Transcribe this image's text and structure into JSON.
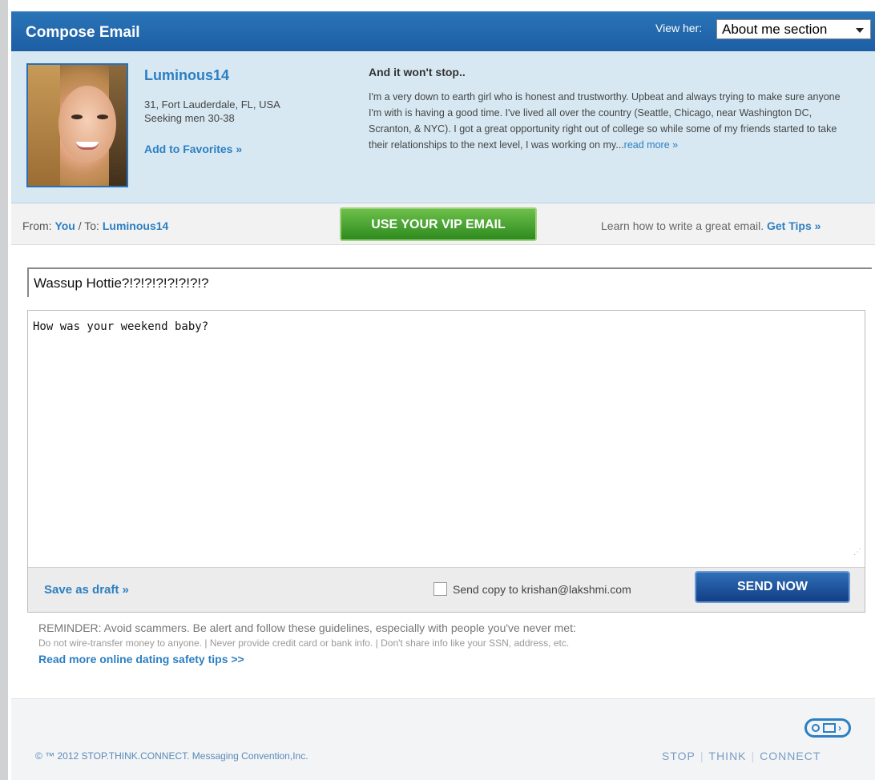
{
  "header": {
    "title": "Compose Email",
    "view_label": "View her:",
    "view_select_value": "About me section"
  },
  "profile": {
    "username": "Luminous14",
    "location": "31, Fort Lauderdale, FL, USA",
    "seeking": "Seeking men 30-38",
    "add_favorites": "Add to Favorites »",
    "about_title": "And it won't stop..",
    "about_text": "I'm a very down to earth girl who is honest and trustworthy. Upbeat and always trying to make sure anyone I'm with is having a good time. I've lived all over the country (Seattle, Chicago, near Washington DC, Scranton, & NYC). I got a great opportunity right out of college so while some of my friends started to take their relationships to the next level, I was working on my...",
    "read_more": "read more »"
  },
  "bar": {
    "from_label": "From:",
    "from_value": "You",
    "to_label": " / To:",
    "to_value": "Luminous14",
    "vip_button": "USE YOUR VIP EMAIL",
    "tips_text": "Learn how to write a great email.",
    "tips_link": "Get Tips »"
  },
  "compose": {
    "subject": "Wassup Hottie?!?!?!?!?!?!?!?",
    "body": "How was your weekend baby?",
    "save_draft": "Save as draft »",
    "send_copy_label": "Send copy to krishan@lakshmi.com",
    "send_copy_checked": false,
    "send_button": "SEND NOW"
  },
  "reminder": {
    "title": "REMINDER: Avoid scammers. Be alert and follow these guidelines, especially with people you've never met:",
    "line": "Do not wire-transfer money to anyone. | Never provide credit card or bank info. | Don't share info like your SSN, address, etc.",
    "safety_link": "Read more online dating safety tips >>"
  },
  "footer": {
    "copyright": "© ™ 2012 STOP.THINK.CONNECT. Messaging Convention,Inc.",
    "stop": "STOP",
    "think": "THINK",
    "connect": "CONNECT"
  },
  "colors": {
    "header_blue": "#1d5ea3",
    "link_blue": "#2c7fc2",
    "vip_green": "#2e8a1e",
    "send_navy": "#123e86",
    "profile_bg": "#d7e8f3"
  }
}
